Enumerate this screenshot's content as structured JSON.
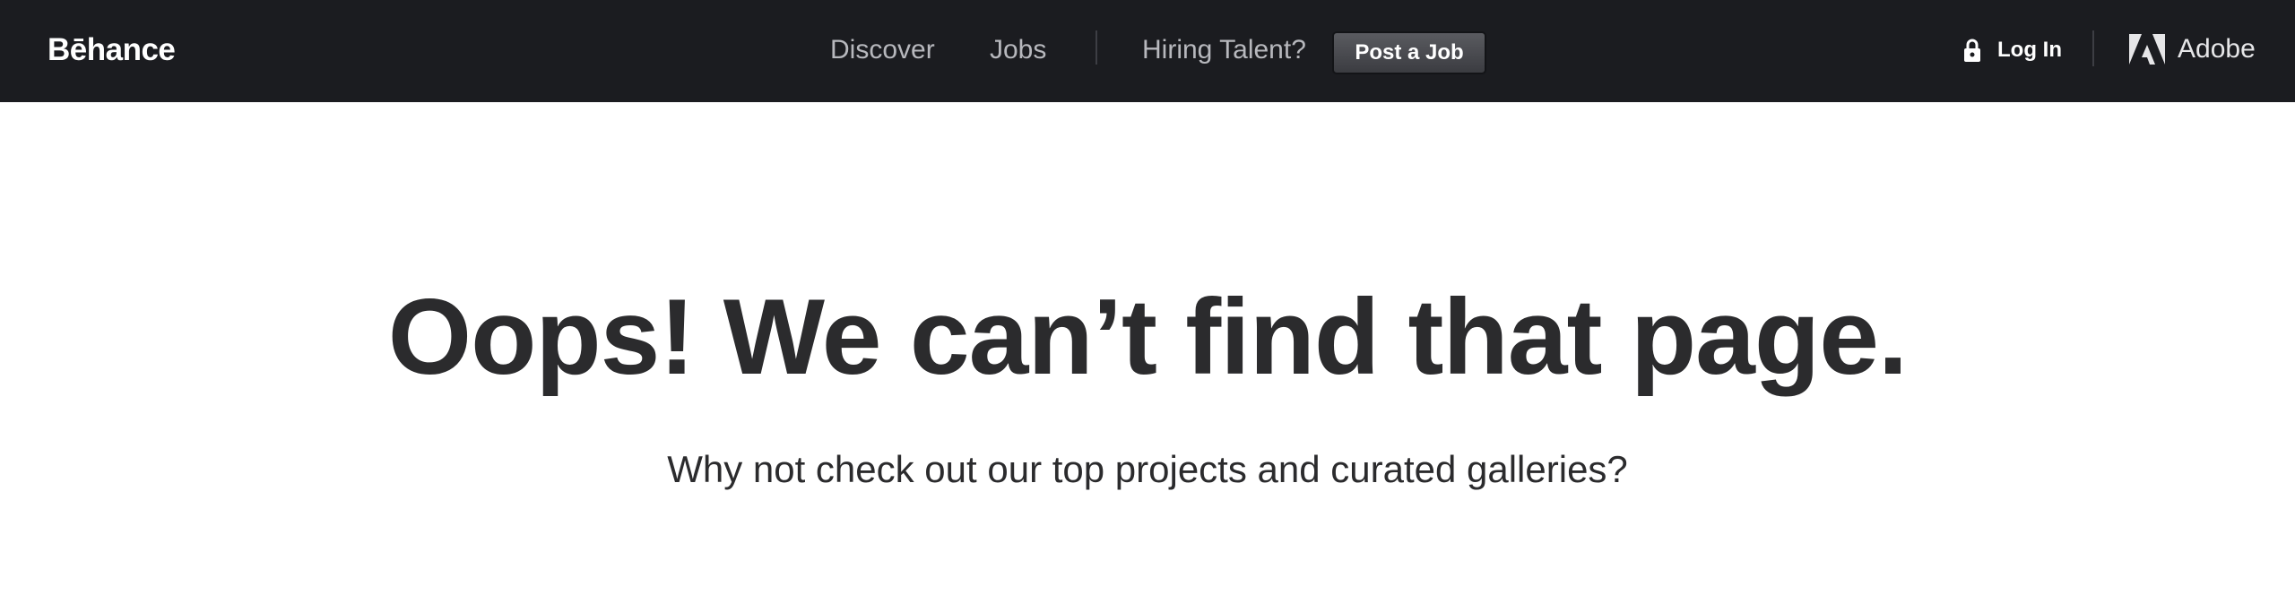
{
  "header": {
    "logo": "Bēhance",
    "nav": {
      "discover": "Discover",
      "jobs": "Jobs",
      "hiring": "Hiring Talent?",
      "post_job": "Post a Job"
    },
    "login_label": "Log In",
    "adobe_label": "Adobe",
    "icons": {
      "lock": "lock-icon",
      "adobe": "adobe-logo-icon"
    }
  },
  "main": {
    "headline": "Oops! We can’t find that page.",
    "subtext": "Why not check out our top projects and curated galleries?"
  },
  "colors": {
    "header_bg": "#1b1c20",
    "nav_text": "#b7b8bd",
    "body_text": "#2b2b2d"
  }
}
